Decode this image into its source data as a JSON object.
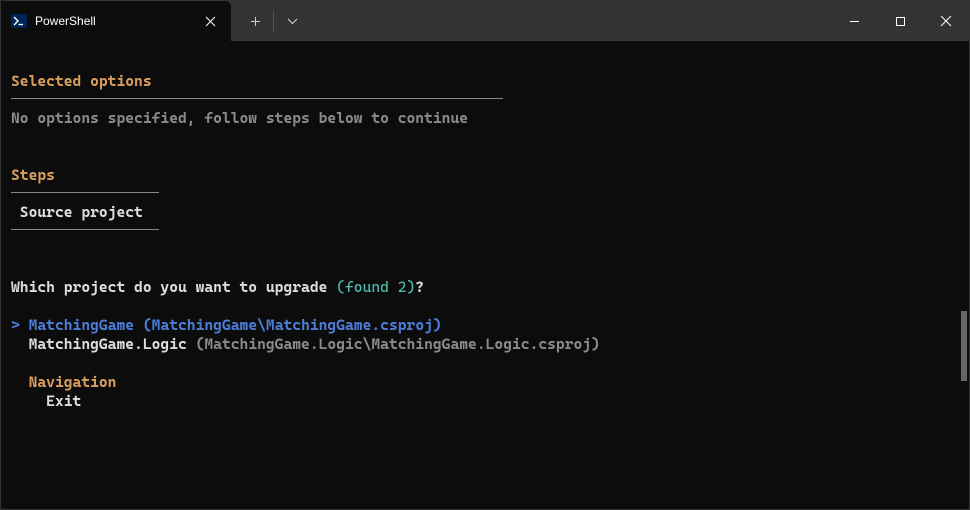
{
  "titlebar": {
    "tab_title": "PowerShell"
  },
  "content": {
    "selected_options_heading": "Selected options",
    "no_options_text": "No options specified, follow steps below to continue",
    "steps_heading": "Steps",
    "step1": "Source project",
    "prompt_q_prefix": "Which project do you want to upgrade ",
    "prompt_q_count": "(found 2)",
    "prompt_q_suffix": "?",
    "caret": ">",
    "option1_name": "MatchingGame ",
    "option1_path": "(MatchingGame\\MatchingGame.csproj)",
    "option2_name": "MatchingGame.Logic ",
    "option2_path": "(MatchingGame.Logic\\MatchingGame.Logic.csproj)",
    "nav_heading": "Navigation",
    "nav_exit": "Exit"
  }
}
